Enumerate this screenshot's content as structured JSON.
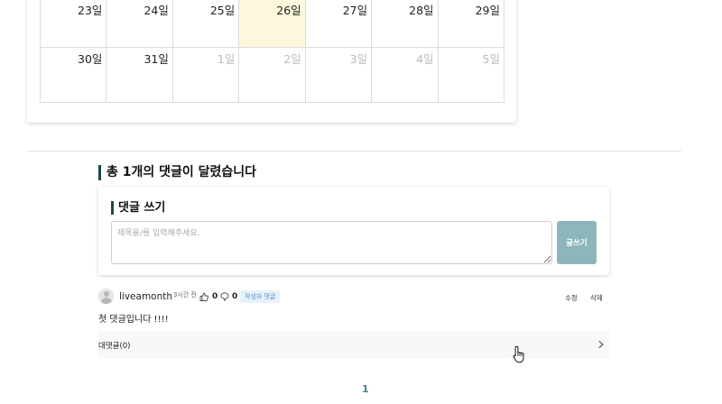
{
  "calendar": {
    "rows": [
      [
        {
          "label": "23일",
          "state": "normal"
        },
        {
          "label": "24일",
          "state": "normal"
        },
        {
          "label": "25일",
          "state": "normal"
        },
        {
          "label": "26일",
          "state": "today"
        },
        {
          "label": "27일",
          "state": "normal"
        },
        {
          "label": "28일",
          "state": "normal"
        },
        {
          "label": "29일",
          "state": "normal"
        }
      ],
      [
        {
          "label": "30일",
          "state": "normal"
        },
        {
          "label": "31일",
          "state": "normal"
        },
        {
          "label": "1일",
          "state": "muted"
        },
        {
          "label": "2일",
          "state": "muted"
        },
        {
          "label": "3일",
          "state": "muted"
        },
        {
          "label": "4일",
          "state": "muted"
        },
        {
          "label": "5일",
          "state": "muted"
        }
      ]
    ],
    "today_color": "#fdf8dd",
    "muted_color": "#bbbbbb"
  },
  "comments": {
    "heading": "총 1개의 댓글이 달렸습니다",
    "write": {
      "title": "댓글 쓰기",
      "placeholder": "제목을/를 입력해주세요.",
      "submit_label": "글쓰기",
      "submit_color": "#8db6bc"
    },
    "items": [
      {
        "author": "liveamonth",
        "time": "3시간 전",
        "likes": "0",
        "dislikes": "0",
        "badge": "작성자 댓글",
        "edit_label": "수정",
        "delete_label": "삭제",
        "body": "첫 댓글입니다 !!!!",
        "reply_label": "대댓글(0)"
      }
    ]
  },
  "pagination": {
    "current": "1",
    "accent_color": "#3a8a86"
  },
  "icons": {
    "like": "thumbs-up-icon",
    "dislike": "thumbs-down-icon",
    "reply_toggle": "chevron-right-icon",
    "cursor": "hand-pointer-icon",
    "avatar": "user-avatar-icon"
  }
}
